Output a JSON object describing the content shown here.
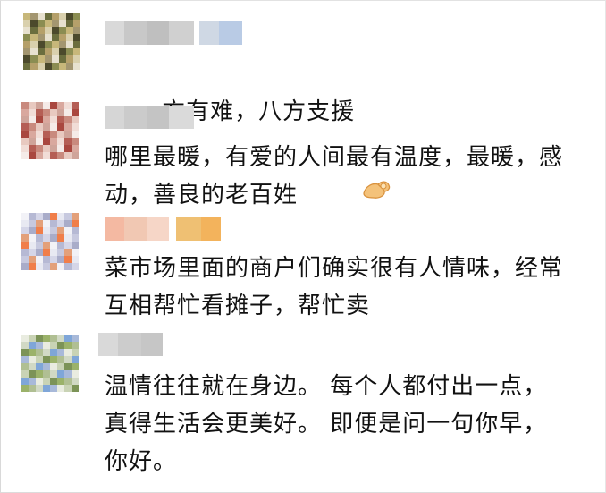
{
  "comments": [
    {
      "text": "一方有难，八方支援",
      "emoji": "ok-hand-emoji",
      "avatar_colors": [
        "#c7b77a",
        "#8b8d52",
        "#4c4a2c",
        "#d9d0ad",
        "#b5a06a",
        "#6b6e3e",
        "#e7e1cf",
        "#a39670"
      ],
      "name_colors": [
        "#d9d9d9",
        "#c8c8c8",
        "#bfbfbf",
        "#d0d0d0",
        "#cfd8e4",
        "#b9cbe5"
      ]
    },
    {
      "text": "哪里最暖，有爱的人间最有温度，最暖，感动，善良的老百姓",
      "avatar_colors": [
        "#e8c9c0",
        "#c98a7e",
        "#b55e55",
        "#f1ddd7",
        "#d9a89e",
        "#a9473f",
        "#f5ebe8",
        "#cfa49a"
      ],
      "name_colors": [
        "#d6d6d6",
        "#cbcbcb",
        "#c4c4c4",
        "#dadada"
      ]
    },
    {
      "text": "菜市场里面的商户们确实很有人情味，经常互相帮忙看摊子，帮忙卖",
      "avatar_colors": [
        "#d5d6e8",
        "#b6b9d4",
        "#f2f2f7",
        "#e3a07a",
        "#c7c9df",
        "#e8e9f2",
        "#f07e4a",
        "#a9acc9"
      ],
      "name_colors": [
        "#f4b9a2",
        "#f1c8b3",
        "#f6d6c7",
        "#efc073",
        "#f3b35c"
      ]
    },
    {
      "text": "温情往往就在身边。 每个人都付出一点，真得生活会更美好。 即便是问一句你早，你好。",
      "avatar_colors": [
        "#9bb26a",
        "#7c9357",
        "#c9d3b5",
        "#e9ece0",
        "#a8b9d9",
        "#7fa6d8",
        "#d1d9c5",
        "#b0bf93"
      ],
      "name_colors": [
        "#d9d9d9",
        "#cccccc",
        "#c6c6c6"
      ]
    }
  ]
}
